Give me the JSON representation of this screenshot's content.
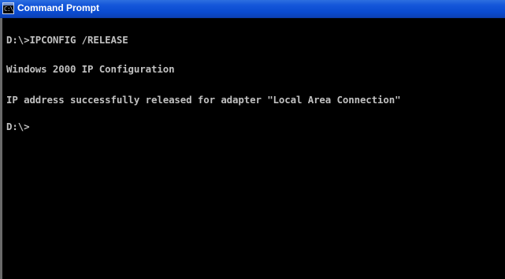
{
  "window": {
    "title": "Command Prompt",
    "icon_label": "C:\\",
    "icon": "command-prompt-icon"
  },
  "console": {
    "lines": [
      "D:\\>IPCONFIG /RELEASE",
      "Windows 2000 IP Configuration",
      "IP address successfully released for adapter \"Local Area Connection\"",
      "D:\\>"
    ]
  }
}
